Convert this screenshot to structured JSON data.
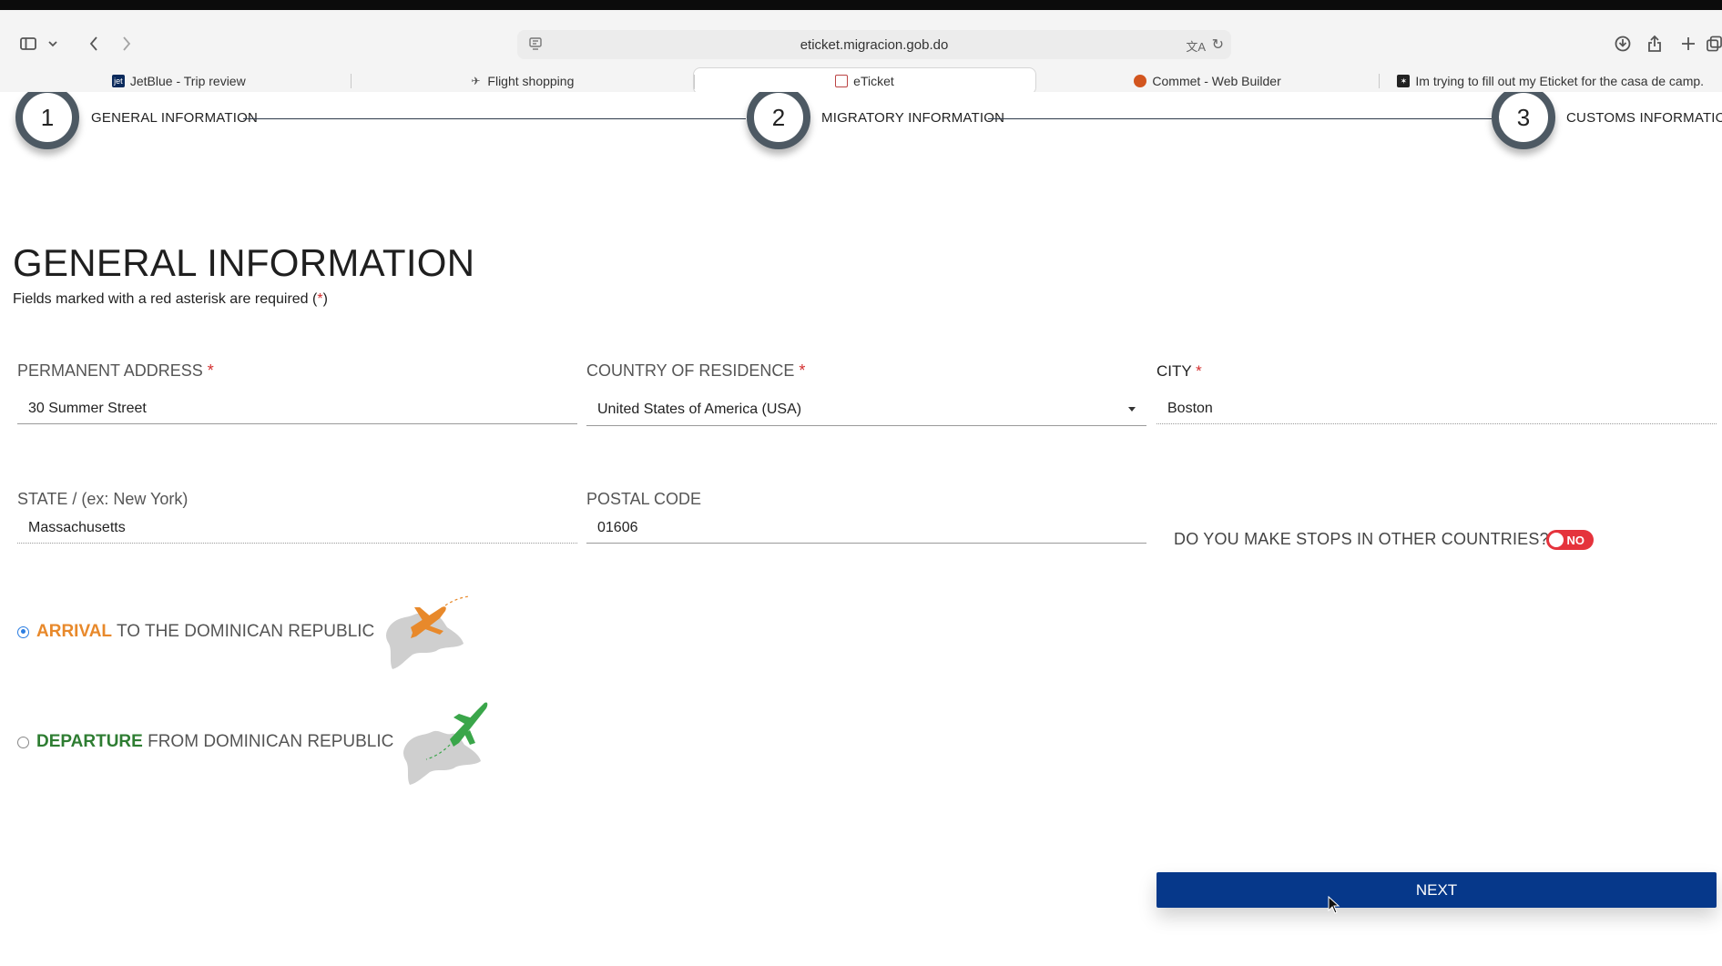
{
  "browser": {
    "url": "eticket.migracion.gob.do",
    "tabs": [
      {
        "label": "JetBlue - Trip review",
        "active": false,
        "favicon": "jetblue-icon"
      },
      {
        "label": "Flight shopping",
        "active": false,
        "favicon": "plane-icon"
      },
      {
        "label": "eTicket",
        "active": true,
        "favicon": "seal-icon"
      },
      {
        "label": "Commet - Web Builder",
        "active": false,
        "favicon": "comet-icon"
      },
      {
        "label": "Im trying to fill out my Eticket for the casa de camp.",
        "active": false,
        "favicon": "sparkle-icon"
      }
    ]
  },
  "stepper": {
    "steps": [
      {
        "number": "1",
        "label": "GENERAL INFORMATION"
      },
      {
        "number": "2",
        "label": "MIGRATORY INFORMATION"
      },
      {
        "number": "3",
        "label": "CUSTOMS INFORMATION"
      }
    ]
  },
  "form": {
    "title": "GENERAL INFORMATION",
    "subtitle_prefix": "Fields marked with a red asterisk are required (",
    "subtitle_asterisk": "*",
    "subtitle_suffix": ")",
    "required_mark": "*",
    "address": {
      "label": "PERMANENT ADDRESS",
      "value": "30 Summer Street"
    },
    "country": {
      "label": "COUNTRY OF RESIDENCE",
      "value": "United States of America (USA)"
    },
    "city": {
      "label": "CITY",
      "value": "Boston"
    },
    "state": {
      "label": "STATE / (ex: New York)",
      "value": "Massachusetts"
    },
    "postal": {
      "label": "POSTAL CODE",
      "value": "01606"
    },
    "stops": {
      "question": "DO YOU MAKE STOPS IN OTHER COUNTRIES?",
      "toggle": "NO"
    },
    "arrival": {
      "keyword": "ARRIVAL",
      "text": " TO THE DOMINICAN REPUBLIC",
      "checked": true
    },
    "departure": {
      "keyword": "DEPARTURE",
      "text": " FROM DOMINICAN REPUBLIC",
      "checked": false
    },
    "next_label": "NEXT"
  },
  "colors": {
    "primary": "#06388a",
    "required": "#d32f2f",
    "arrival": "#e8892b",
    "departure": "#2e7d32",
    "toggle_off": "#e5333c",
    "radio_selected": "#2a7de1"
  }
}
